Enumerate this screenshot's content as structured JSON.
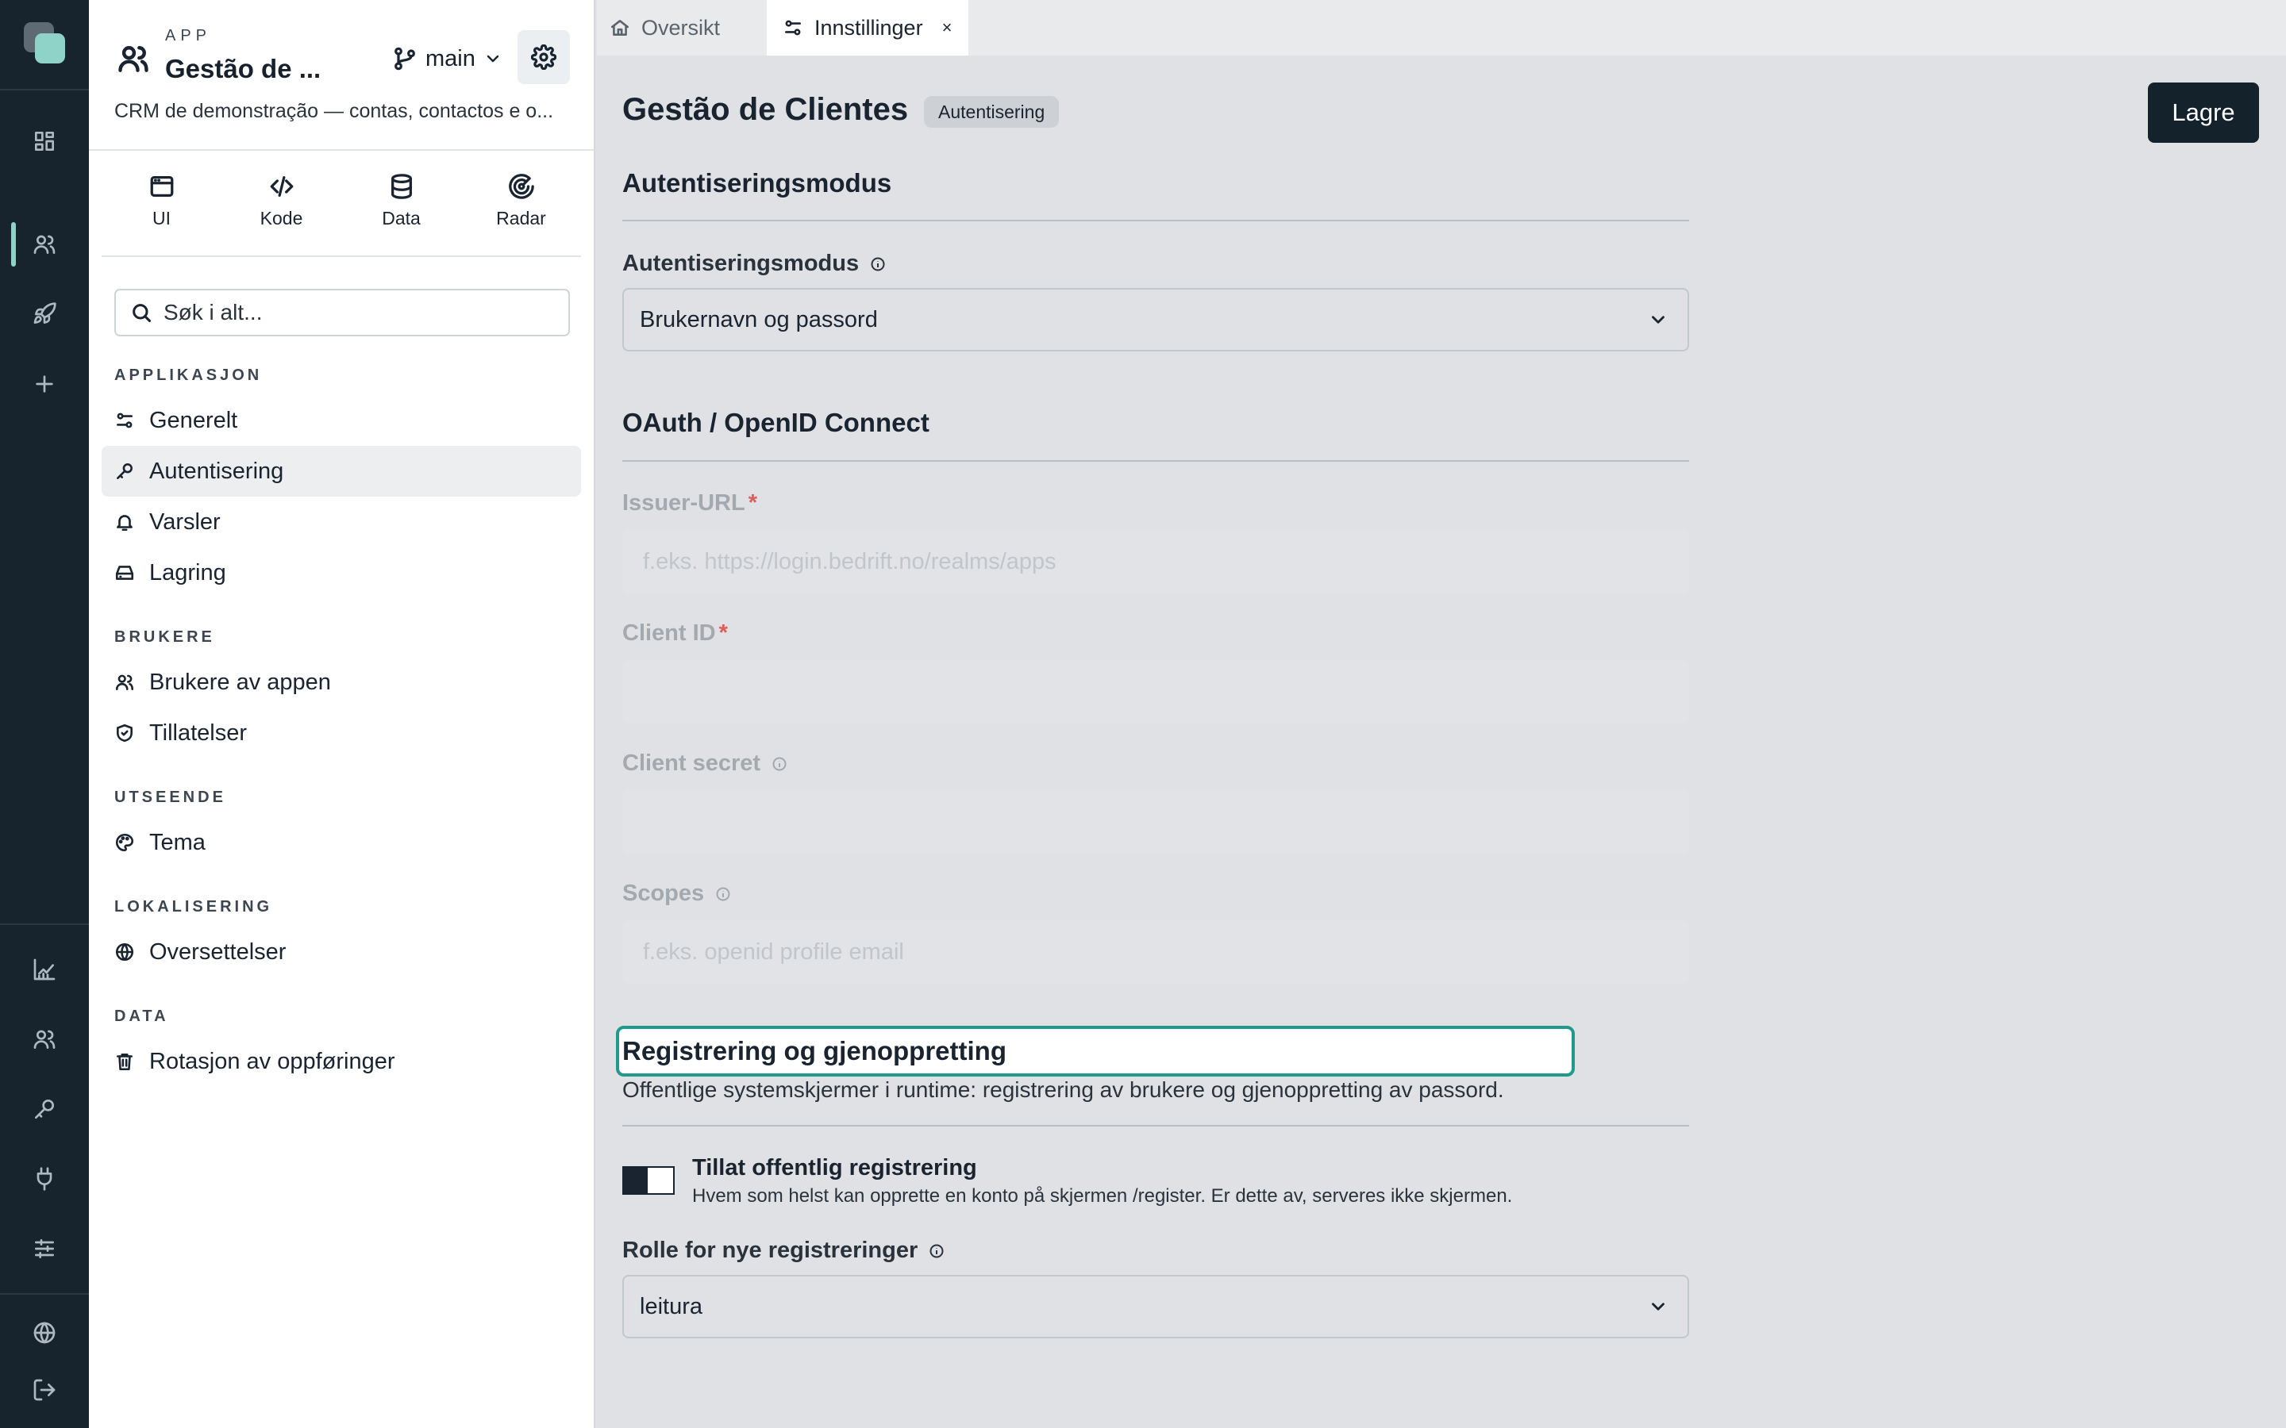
{
  "rail": {
    "icons": [
      "dashboard-icon",
      "users-icon",
      "rocket-icon",
      "plus-icon",
      "chart-icon",
      "users-icon",
      "key-icon",
      "plug-icon",
      "sliders-icon",
      "globe-icon",
      "logout-icon"
    ]
  },
  "app": {
    "kicker": "APP",
    "name": "Gestão de ...",
    "branch": "main",
    "description": "CRM de demonstração — contas, contactos e o..."
  },
  "tools": [
    {
      "label": "UI",
      "icon": "window-icon"
    },
    {
      "label": "Kode",
      "icon": "code-icon"
    },
    {
      "label": "Data",
      "icon": "database-icon"
    },
    {
      "label": "Radar",
      "icon": "radar-icon"
    }
  ],
  "search": {
    "placeholder": "Søk i alt..."
  },
  "nav": {
    "sections": [
      {
        "title": "APPLIKASJON",
        "items": [
          "Generelt",
          "Autentisering",
          "Varsler",
          "Lagring"
        ]
      },
      {
        "title": "BRUKERE",
        "items": [
          "Brukere av appen",
          "Tillatelser"
        ]
      },
      {
        "title": "UTSEENDE",
        "items": [
          "Tema"
        ]
      },
      {
        "title": "LOKALISERING",
        "items": [
          "Oversettelser"
        ]
      },
      {
        "title": "DATA",
        "items": [
          "Rotasjon av oppføringer"
        ]
      }
    ],
    "active": "Autentisering"
  },
  "tabs": [
    {
      "label": "Oversikt",
      "icon": "home-icon"
    },
    {
      "label": "Innstillinger",
      "icon": "settings-sliders-icon",
      "close": "×"
    }
  ],
  "page": {
    "title": "Gestão de Clientes",
    "badge": "Autentisering",
    "save_label": "Lagre"
  },
  "auth": {
    "section_title": "Autentiseringsmodus",
    "mode_label": "Autentiseringsmodus",
    "mode_value": "Brukernavn og passord"
  },
  "oauth": {
    "section_title": "OAuth / OpenID Connect",
    "issuer_label": "Issuer-URL",
    "issuer_placeholder": "f.eks. https://login.bedrift.no/realms/apps",
    "client_id_label": "Client ID",
    "client_secret_label": "Client secret",
    "scopes_label": "Scopes",
    "scopes_placeholder": "f.eks. openid profile email",
    "required_mark": "*"
  },
  "registration": {
    "section_title": "Registrering og gjenoppretting",
    "description": "Offentlige systemskjermer i runtime: registrering av brukere og gjenoppretting av passord.",
    "toggle_title": "Tillat offentlig registrering",
    "toggle_desc": "Hvem som helst kan opprette en konto på skjermen /register. Er dette av, serveres ikke skjermen.",
    "toggle_on": true,
    "role_label": "Rolle for nye registreringer",
    "role_value": "leitura"
  },
  "colors": {
    "rail_bg": "#17242e",
    "accent": "#8fd3c8",
    "focus": "#1f9a8c",
    "primary_button": "#14222c"
  }
}
